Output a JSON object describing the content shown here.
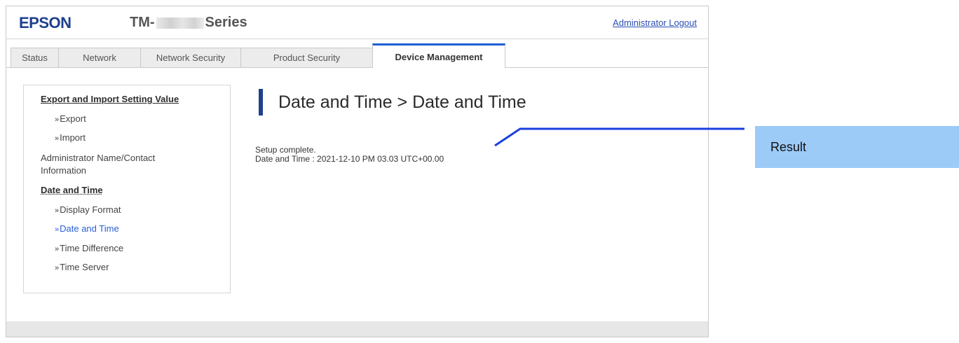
{
  "header": {
    "logo": "EPSON",
    "model_prefix": "TM-",
    "model_suffix": "Series",
    "logout_label": "Administrator Logout"
  },
  "tabs": [
    {
      "label": "Status"
    },
    {
      "label": "Network"
    },
    {
      "label": "Network Security"
    },
    {
      "label": "Product Security"
    },
    {
      "label": "Device Management"
    }
  ],
  "sidebar": {
    "section1": "Export and Import Setting Value",
    "export": "Export",
    "import": "Import",
    "admin_line1": "Administrator Name/Contact",
    "admin_line2": "Information",
    "section2": "Date and Time",
    "display_format": "Display Format",
    "date_and_time": "Date and Time",
    "time_difference": "Time Difference",
    "time_server": "Time Server"
  },
  "main": {
    "title": "Date and Time > Date and Time",
    "status_line": "Setup complete.",
    "datetime_line": "Date and Time : 2021-12-10 PM 03.03 UTC+00.00"
  },
  "callout": {
    "label": "Result",
    "color": "#9dcbf8"
  }
}
